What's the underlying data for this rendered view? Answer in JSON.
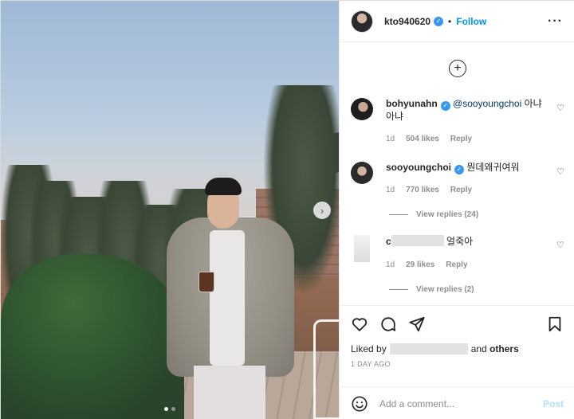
{
  "post": {
    "author": "kto940620",
    "verified": true,
    "follow_label": "Follow",
    "separator": "•",
    "more_icon": "ellipsis-icon",
    "carousel_next": "›"
  },
  "load_more_icon": "plus-circle-icon",
  "load_more_symbol": "+",
  "comments": [
    {
      "user": "bohyunahn",
      "verified": true,
      "mention": "@sooyoungchoi",
      "text": "아냐 아냐",
      "age": "1d",
      "likes": "504 likes",
      "reply_label": "Reply"
    },
    {
      "user": "sooyoungchoi",
      "verified": true,
      "text": "뭔데왜귀여워",
      "age": "1d",
      "likes": "770 likes",
      "reply_label": "Reply",
      "view_replies": "View replies (24)"
    },
    {
      "user": "c",
      "text": "얼죽아",
      "age": "1d",
      "likes": "29 likes",
      "reply_label": "Reply",
      "view_replies": "View replies (2)"
    }
  ],
  "actions": {
    "like_icon": "heart-icon",
    "comment_icon": "comment-icon",
    "share_icon": "paper-plane-icon",
    "save_icon": "bookmark-icon"
  },
  "liked_by": {
    "prefix": "Liked by",
    "connector": "and",
    "others": "others"
  },
  "timestamp": "1 DAY AGO",
  "add_comment": {
    "placeholder": "Add a comment...",
    "post_label": "Post"
  },
  "colors": {
    "link_blue": "#0095f6",
    "verified_blue": "#3897f0",
    "muted": "#8e8e8e"
  }
}
